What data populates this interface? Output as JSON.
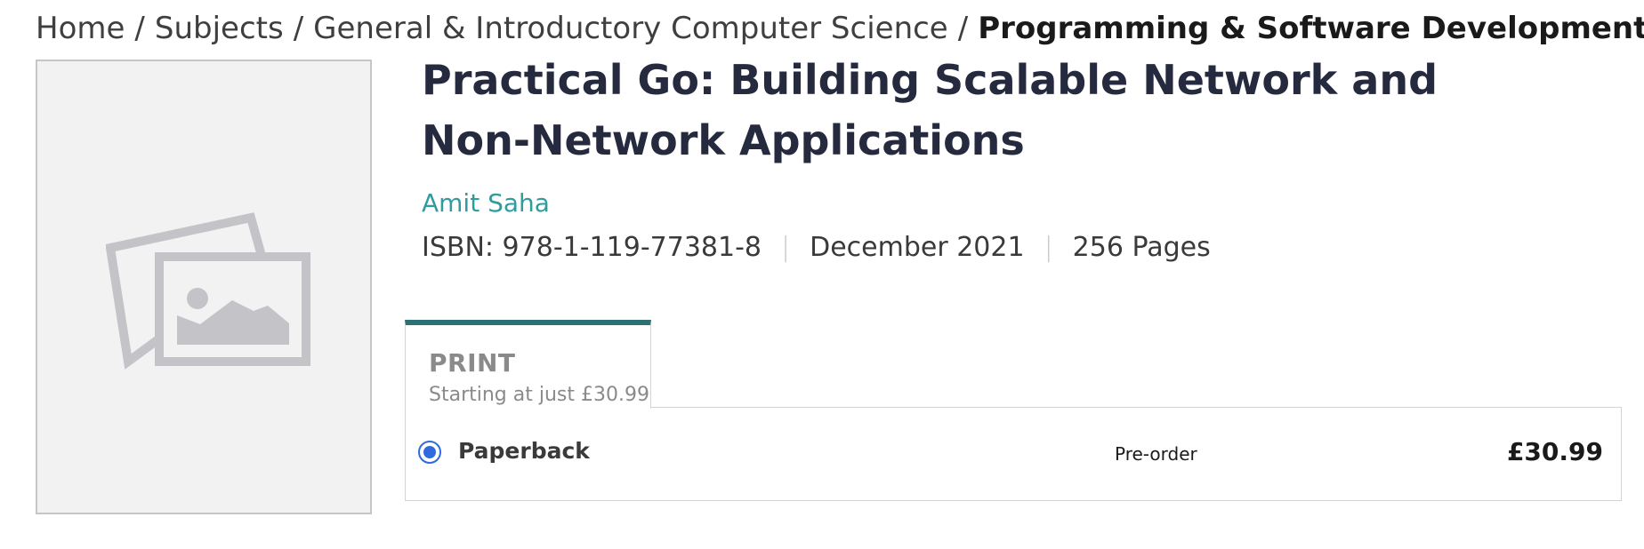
{
  "breadcrumb": {
    "items": [
      "Home",
      "Subjects",
      "General & Introductory Computer Science"
    ],
    "separator": "/",
    "current": "Programming & Software Development"
  },
  "cover": {
    "icon": "image-placeholder-icon"
  },
  "book": {
    "title": "Practical Go: Building Scalable Network and Non-Network Applications",
    "author": "Amit Saha",
    "isbn": "ISBN: 978-1-119-77381-8",
    "date": "December 2021",
    "pages": "256 Pages"
  },
  "purchase": {
    "tab": {
      "label": "PRINT",
      "sublabel": "Starting at just £30.99"
    },
    "option": {
      "format": "Paperback",
      "status": "Pre-order",
      "price": "£30.99",
      "selected": true
    }
  },
  "colors": {
    "accent": "#2c7275",
    "author_link": "#2f9c9e",
    "radio": "#2f6bdc",
    "title": "#262a3f"
  }
}
